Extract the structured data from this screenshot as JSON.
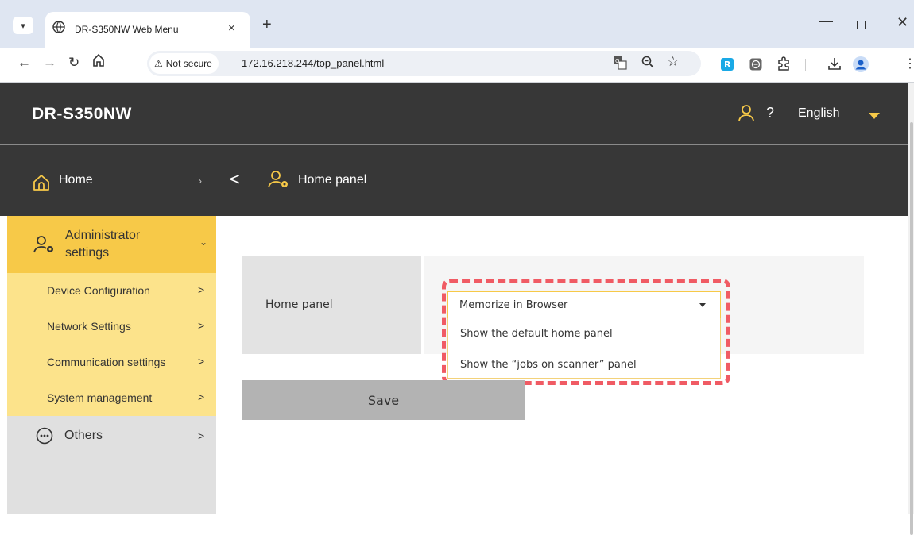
{
  "browser": {
    "tab_title": "DR-S350NW Web Menu",
    "tab_close": "×",
    "new_tab": "+",
    "security_label": "Not secure",
    "url": "172.16.218.244/top_panel.html",
    "window_controls": {
      "minimize": "—",
      "close": "✕"
    }
  },
  "header": {
    "brand": "DR-S350NW",
    "help": "?",
    "language": "English"
  },
  "breadcrumb": {
    "home": "Home",
    "separator": "›",
    "back": "<",
    "current": "Home panel"
  },
  "sidebar": {
    "admin_label": "Administrator settings",
    "items": [
      {
        "label": "Device Configuration"
      },
      {
        "label": "Network Settings"
      },
      {
        "label": "Communication settings"
      },
      {
        "label": "System management"
      }
    ],
    "others_label": "Others",
    "chevron": ">"
  },
  "form": {
    "row_label": "Home panel",
    "select_value": "Memorize in Browser",
    "options": [
      "Show the default home panel",
      "Show the “jobs on scanner” panel"
    ],
    "save_label": "Save"
  },
  "colors": {
    "accent": "#f7c948",
    "header_bg": "#373737",
    "highlight": "#f05b64"
  }
}
